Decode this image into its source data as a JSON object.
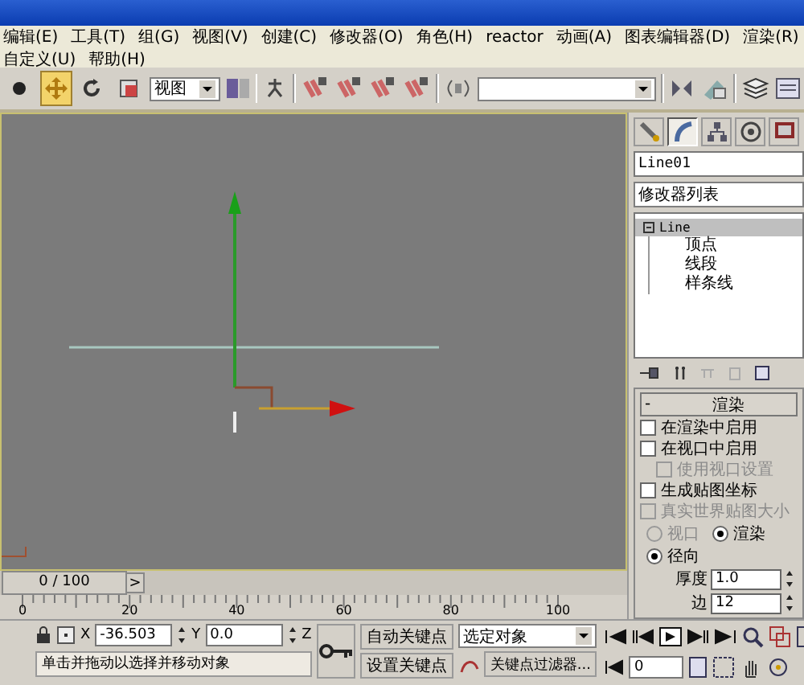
{
  "menu": [
    "编辑(E)",
    "工具(T)",
    "组(G)",
    "视图(V)",
    "创建(C)",
    "修改器(O)",
    "角色(H)",
    "reactor",
    "动画(A)",
    "图表编辑器(D)",
    "渲染(R)",
    "自定义(U)",
    "帮助(H)"
  ],
  "toolbar": {
    "view_dropdown": "视图",
    "tools": [
      {
        "kind": "select",
        "selected": false
      },
      {
        "kind": "move",
        "selected": true
      },
      {
        "kind": "rotate",
        "selected": false
      },
      {
        "kind": "scale",
        "selected": false
      }
    ]
  },
  "command_panel": {
    "tabs": [
      {
        "kind": "create",
        "selected": false
      },
      {
        "kind": "modify",
        "selected": true
      },
      {
        "kind": "hierarchy",
        "selected": false
      },
      {
        "kind": "motion",
        "selected": false
      },
      {
        "kind": "display",
        "selected": false
      }
    ],
    "object_name": "Line01",
    "modifier_list": "修改器列表",
    "stack": [
      {
        "label": "Line",
        "expanded": true,
        "selected": true,
        "children": [
          {
            "label": "顶点"
          },
          {
            "label": "线段"
          },
          {
            "label": "样条线"
          }
        ]
      }
    ],
    "rollout": {
      "sign": "-",
      "title": "渲染",
      "options": [
        {
          "label": "在渲染中启用",
          "checked": false,
          "disabled": false
        },
        {
          "label": "在视口中启用",
          "checked": false,
          "disabled": false
        },
        {
          "label": "使用视口设置",
          "checked": false,
          "disabled": true
        },
        {
          "label": "生成贴图坐标",
          "checked": false,
          "disabled": false
        },
        {
          "label": "真实世界贴图大小",
          "checked": false,
          "disabled": true
        }
      ],
      "view_radios": [
        {
          "label": "视口",
          "selected": false,
          "disabled": true
        },
        {
          "label": "渲染",
          "selected": true,
          "disabled": false
        }
      ],
      "shape_radios": [
        {
          "label": "径向",
          "selected": true,
          "disabled": false
        }
      ],
      "spinners": [
        {
          "label": "厚度",
          "value": "1.0"
        },
        {
          "label": "边",
          "value": "12"
        }
      ]
    }
  },
  "timeline": {
    "frame": "0 / 100",
    "next": ">",
    "ruler": [
      "0",
      "20",
      "40",
      "60",
      "80",
      "100"
    ]
  },
  "bottom": {
    "x_label": "X",
    "x_value": "-36.503",
    "y_label": "Y",
    "y_value": "0.0",
    "z_label": "Z",
    "auto_key": "自动关键点",
    "set_key": "设置关键点",
    "key_mode": "选定对象",
    "key_filters": "关键点过滤器...",
    "current_frame": "0",
    "status": "单击并拖动以选择并移动对象"
  }
}
